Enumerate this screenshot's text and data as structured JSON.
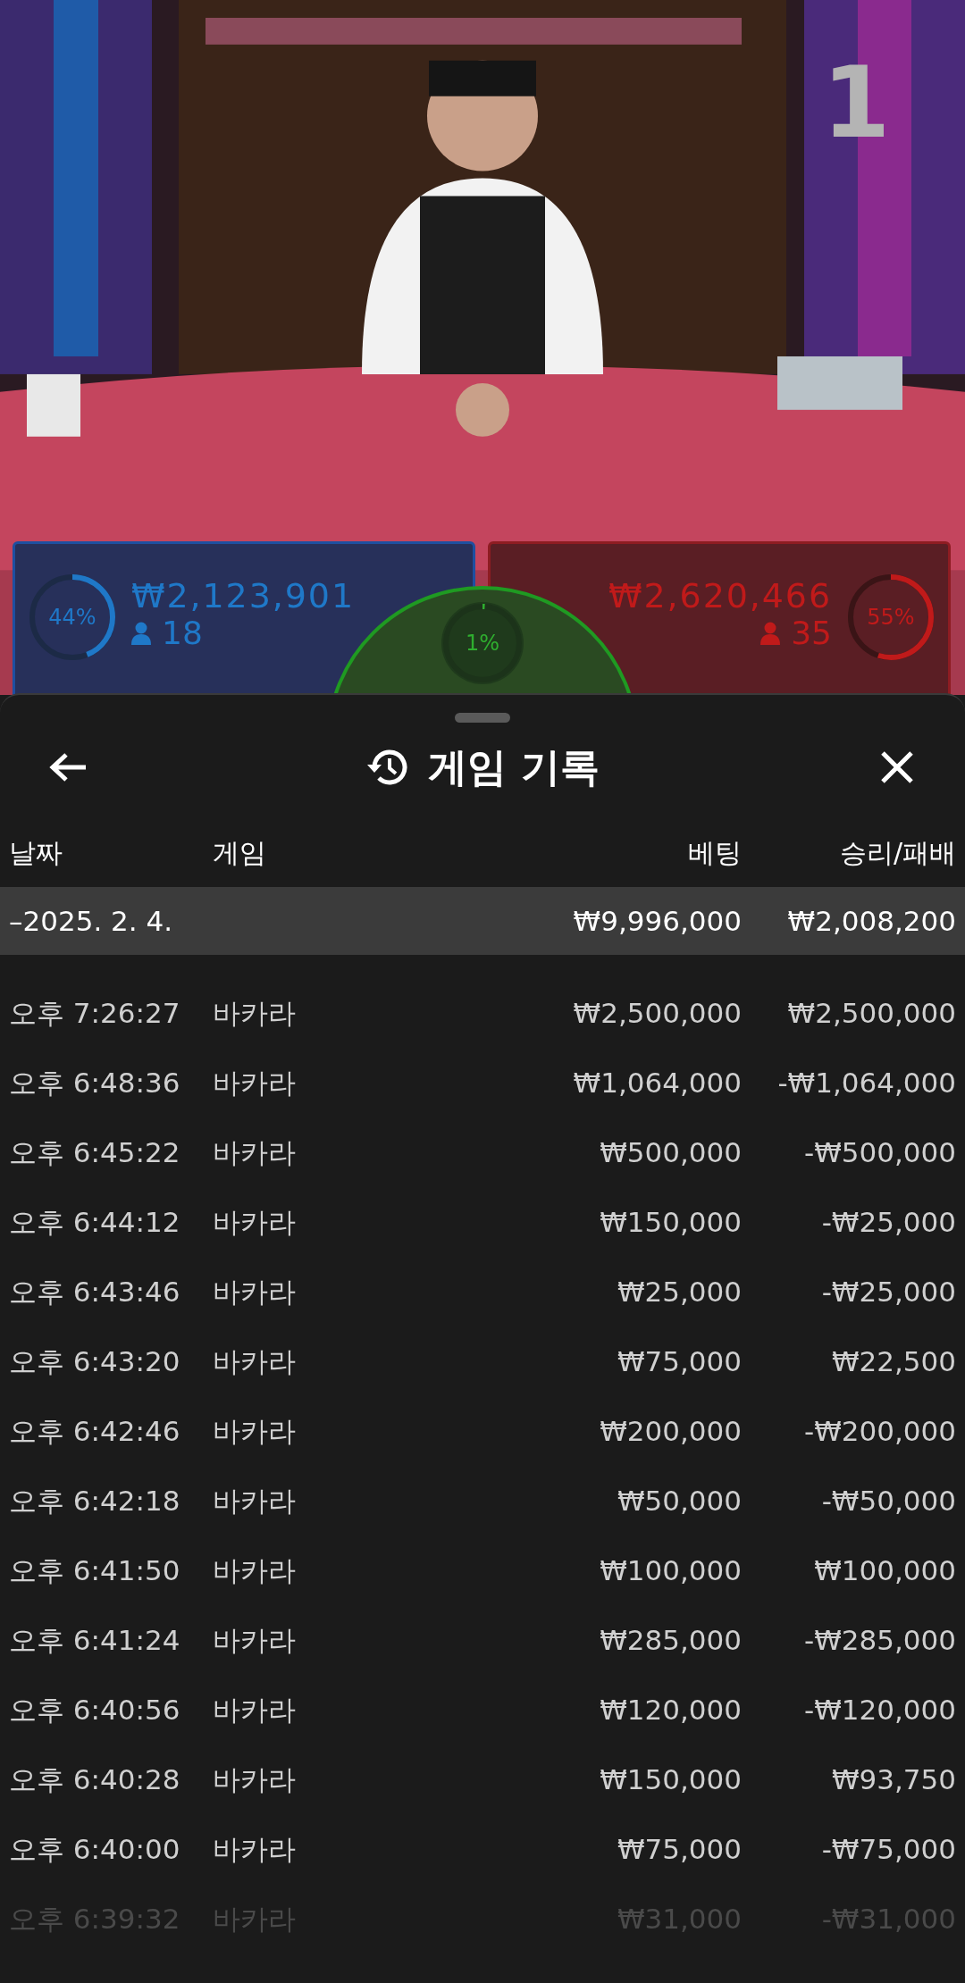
{
  "video": {
    "round": "1"
  },
  "bets": {
    "player": {
      "percent": "44%",
      "level": 0.44,
      "amount": "₩2,123,901",
      "players": "18"
    },
    "tie": {
      "percent": "1%",
      "level": 0.01
    },
    "banker": {
      "percent": "55%",
      "level": 0.55,
      "amount": "₩2,620,466",
      "players": "35"
    }
  },
  "sheet": {
    "title": "게임 기록",
    "columns": [
      "날짜",
      "게임",
      "베팅",
      "승리/패배"
    ],
    "summary": {
      "date": "–2025. 2. 4.",
      "bet": "₩9,996,000",
      "result": "₩2,008,200"
    },
    "rows": [
      {
        "time": "오후 7:26:27",
        "game": "바카라",
        "bet": "₩2,500,000",
        "result": "₩2,500,000",
        "dimmed": false
      },
      {
        "time": "오후 6:48:36",
        "game": "바카라",
        "bet": "₩1,064,000",
        "result": "-₩1,064,000",
        "dimmed": false
      },
      {
        "time": "오후 6:45:22",
        "game": "바카라",
        "bet": "₩500,000",
        "result": "-₩500,000",
        "dimmed": false
      },
      {
        "time": "오후 6:44:12",
        "game": "바카라",
        "bet": "₩150,000",
        "result": "-₩25,000",
        "dimmed": false
      },
      {
        "time": "오후 6:43:46",
        "game": "바카라",
        "bet": "₩25,000",
        "result": "-₩25,000",
        "dimmed": false
      },
      {
        "time": "오후 6:43:20",
        "game": "바카라",
        "bet": "₩75,000",
        "result": "₩22,500",
        "dimmed": false
      },
      {
        "time": "오후 6:42:46",
        "game": "바카라",
        "bet": "₩200,000",
        "result": "-₩200,000",
        "dimmed": false
      },
      {
        "time": "오후 6:42:18",
        "game": "바카라",
        "bet": "₩50,000",
        "result": "-₩50,000",
        "dimmed": false
      },
      {
        "time": "오후 6:41:50",
        "game": "바카라",
        "bet": "₩100,000",
        "result": "₩100,000",
        "dimmed": false
      },
      {
        "time": "오후 6:41:24",
        "game": "바카라",
        "bet": "₩285,000",
        "result": "-₩285,000",
        "dimmed": false
      },
      {
        "time": "오후 6:40:56",
        "game": "바카라",
        "bet": "₩120,000",
        "result": "-₩120,000",
        "dimmed": false
      },
      {
        "time": "오후 6:40:28",
        "game": "바카라",
        "bet": "₩150,000",
        "result": "₩93,750",
        "dimmed": false
      },
      {
        "time": "오후 6:40:00",
        "game": "바카라",
        "bet": "₩75,000",
        "result": "-₩75,000",
        "dimmed": false
      },
      {
        "time": "오후 6:39:32",
        "game": "바카라",
        "bet": "₩31,000",
        "result": "-₩31,000",
        "dimmed": true
      }
    ]
  }
}
